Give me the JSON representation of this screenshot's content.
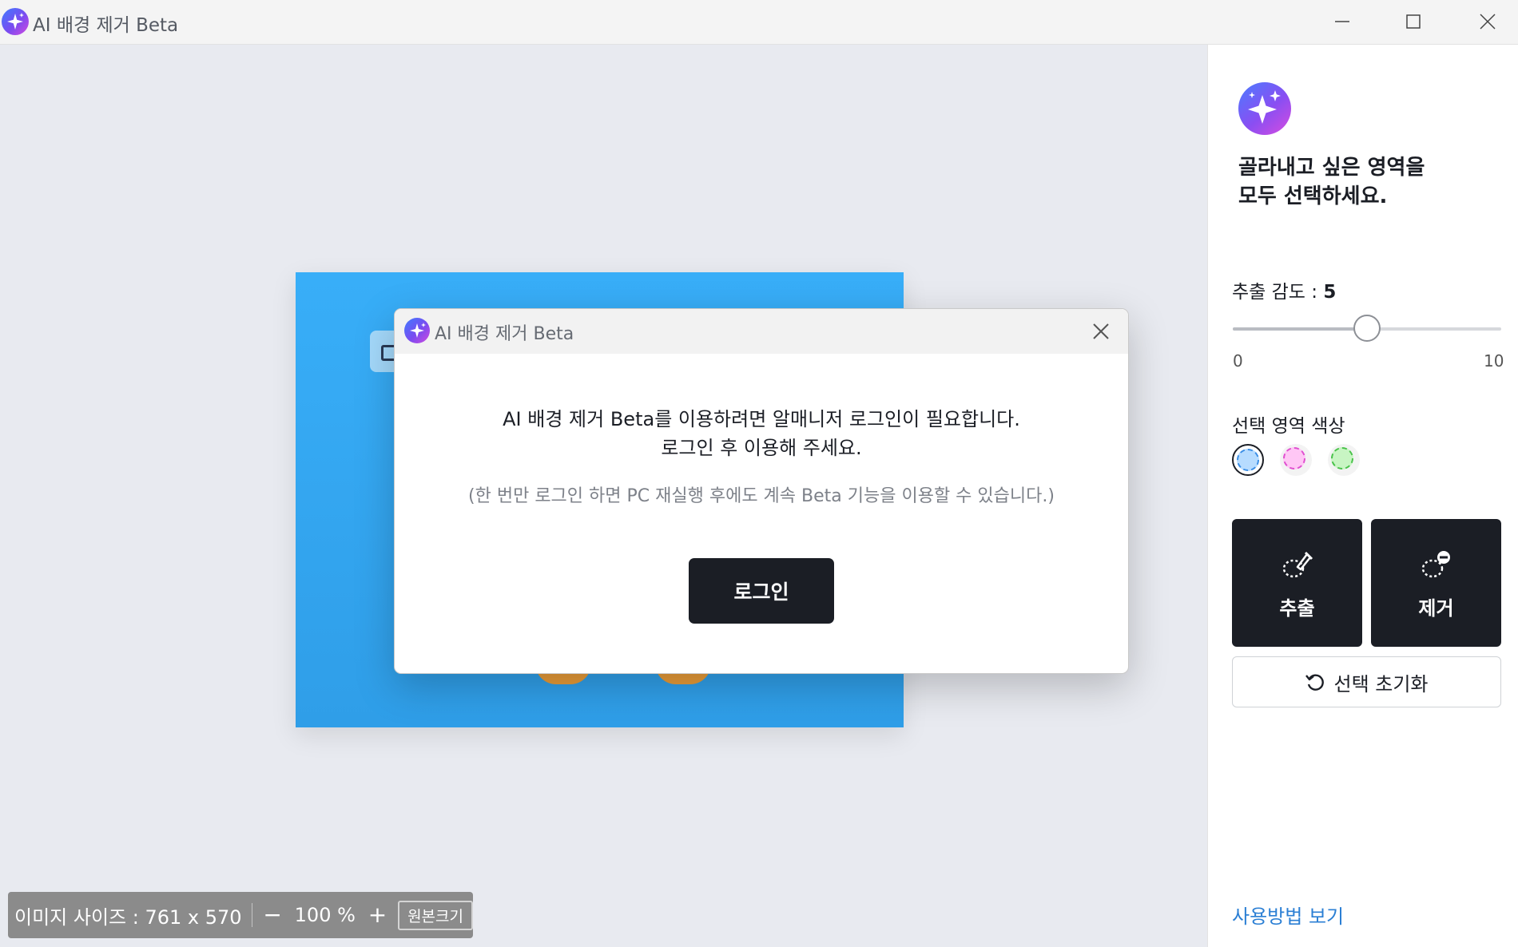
{
  "window": {
    "title": "AI 배경 제거 Beta",
    "icons": {
      "app": "sparkle-icon",
      "minimize": "minimize-icon",
      "maximize": "maximize-icon",
      "close": "close-icon"
    }
  },
  "canvas": {
    "status": {
      "image_size": "이미지 사이즈 : 761 x 570",
      "zoom_out": "−",
      "zoom": "100 %",
      "zoom_in": "+",
      "original_size": "원본크기"
    }
  },
  "panel": {
    "heading_line1": "골라내고 싶은 영역을",
    "heading_line2": "모두 선택하세요.",
    "sensitivity": {
      "label": "추출 감도 : ",
      "value": "5",
      "min": "0",
      "max": "10",
      "level": 5
    },
    "color_label": "선택 영역 색상",
    "colors": [
      {
        "name": "blue",
        "fill": "#b7dcff",
        "ring": "#3a8ee6",
        "selected": true
      },
      {
        "name": "pink",
        "fill": "#ffc7f5",
        "ring": "#e04fd0",
        "selected": false
      },
      {
        "name": "green",
        "fill": "#c8f5c3",
        "ring": "#49c24a",
        "selected": false
      }
    ],
    "extract_label": "추출",
    "remove_label": "제거",
    "reset_label": "선택 초기화",
    "help_link": "사용방법 보기"
  },
  "dialog": {
    "title": "AI 배경 제거 Beta",
    "message_line1": "AI 배경 제거 Beta를 이용하려면 알매니저 로그인이 필요합니다.",
    "message_line2": "로그인 후 이용해 주세요.",
    "note": "(한 번만 로그인 하면 PC 재실행 후에도 계속 Beta 기능을 이용할 수 있습니다.)",
    "login_label": "로그인"
  },
  "colors": {
    "dark_button": "#1b1e25",
    "link": "#2b7fd4",
    "image_background": "#38aef8"
  }
}
